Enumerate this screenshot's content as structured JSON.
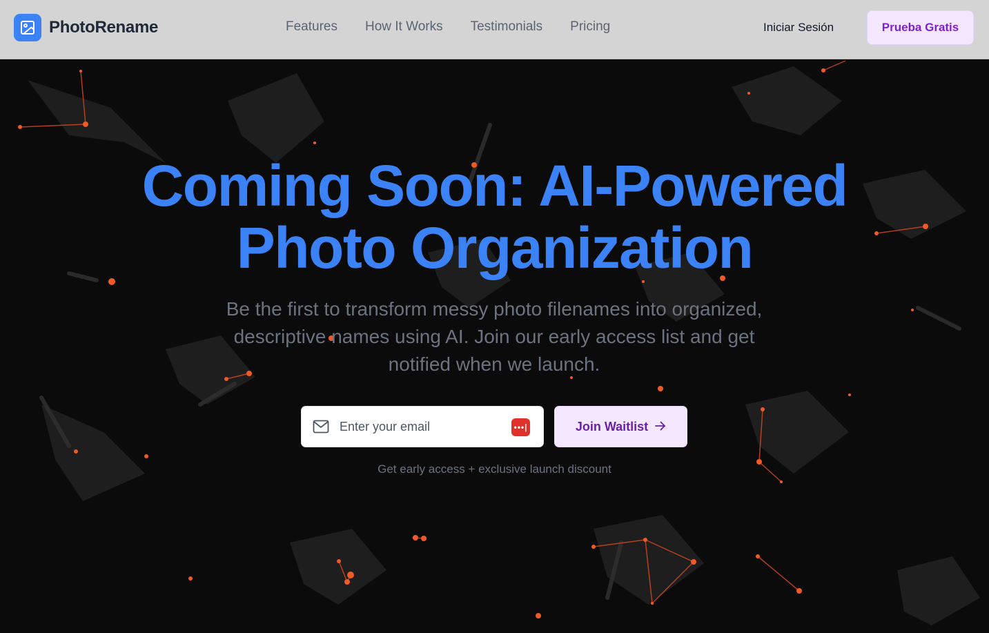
{
  "brand": {
    "name": "PhotoRename",
    "logo_icon": "image-icon",
    "logo_color": "#3b82f6"
  },
  "nav": {
    "links": [
      "Features",
      "How It Works",
      "Testimonials",
      "Pricing"
    ],
    "login_label": "Iniciar Sesión",
    "trial_label": "Prueba Gratis"
  },
  "hero": {
    "title_line1": "Coming Soon: AI-Powered",
    "title_line2": "Photo Organization",
    "subtitle": "Be the first to transform messy photo filenames into organized, descriptive names using AI. Join our early access list and get notified when we launch.",
    "email_placeholder": "Enter your email",
    "join_label": "Join Waitlist",
    "hint": "Get early access + exclusive launch discount"
  },
  "colors": {
    "accent": "#3b82f6",
    "button_bg": "#f3e8ff",
    "button_text": "#7e22ce",
    "particle": "#f05a28",
    "hero_bg": "#0b0b0b"
  }
}
